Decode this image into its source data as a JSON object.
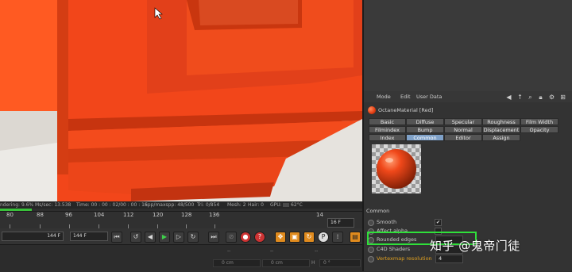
{
  "status_bar": {
    "rendering": "ndering: 9.6%",
    "ms_sec": "Ms/sec: 13.538",
    "time": "Time: 00 : 00 : 02/00 : 00 : 16",
    "spp": "Spp/maxspp: 48/500",
    "tri": "Tri: 0/854",
    "mesh": "Mesh: 2",
    "hair": "Hair: 0",
    "gpu": "GPU:",
    "gpu_temp": "62°C"
  },
  "render_progress": 0.096,
  "timeline": {
    "ticks": [
      "80",
      "88",
      "96",
      "104",
      "112",
      "120",
      "128",
      "136",
      "14"
    ],
    "current_frame": "16 F",
    "start_frame": "144 F",
    "end_frame": "144 F"
  },
  "transport_icons": [
    "go-start-icon",
    "prev-key-icon",
    "play-back-icon",
    "play-icon",
    "next-frame-icon",
    "next-key-icon",
    "go-end-icon",
    "record-icon",
    "autokey-icon",
    "keyframe-icon",
    "move-key-icon",
    "scale-key-icon",
    "rotate-key-icon",
    "param-key-icon",
    "film-icon"
  ],
  "coords": {
    "dashes": [
      "--",
      "--",
      "--"
    ],
    "x": "0 cm",
    "y": "0 cm",
    "h": "H",
    "h_value": "0 °"
  },
  "menubar": {
    "mode": "Mode",
    "edit": "Edit",
    "user_data": "User Data"
  },
  "material": {
    "title": "OctaneMaterial [Red]",
    "tabs_row1": [
      "Basic",
      "Diffuse",
      "Specular",
      "Roughness",
      "Film Width"
    ],
    "tabs_row2": [
      "Filmindex",
      "Bump",
      "Normal",
      "Displacement",
      "Opacity"
    ],
    "tabs_row3": [
      "Index",
      "Common",
      "Editor",
      "Assign"
    ],
    "active_tab": "Common",
    "section": "Common",
    "props": [
      {
        "label": "Smooth",
        "type": "check",
        "value": "✔"
      },
      {
        "label": "Affect alpha",
        "type": "check",
        "value": ""
      },
      {
        "label": "Rounded edges",
        "type": "field",
        "value": ""
      },
      {
        "label": "C4D Shaders",
        "type": "field",
        "value": ""
      },
      {
        "label": "Vertexmap resolution",
        "type": "field",
        "value": "4"
      }
    ]
  },
  "watermark": "知乎 @鬼帝门徒",
  "colors": {
    "object": "#ff4a12",
    "highlight": "#2fe03a",
    "active_tab": "#7fa1c8",
    "vertexmap_label": "#e0a020"
  }
}
